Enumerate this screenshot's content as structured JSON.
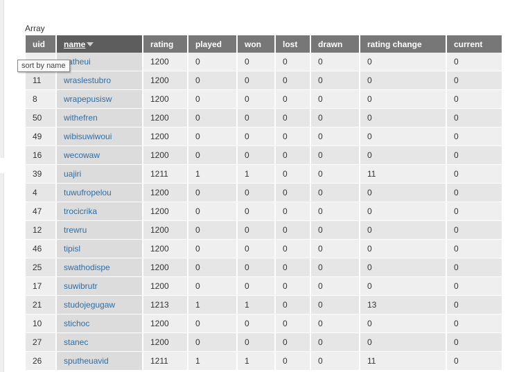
{
  "caption": "Array",
  "tooltip": "sort by name",
  "columns": [
    "uid",
    "name",
    "rating",
    "played",
    "won",
    "lost",
    "drawn",
    "rating change",
    "current"
  ],
  "sort": {
    "column": "name",
    "direction": "descending"
  },
  "rows": [
    [
      "",
      "satheui",
      "1200",
      "0",
      "0",
      "0",
      "0",
      "0",
      "0"
    ],
    [
      "11",
      "wraslestubro",
      "1200",
      "0",
      "0",
      "0",
      "0",
      "0",
      "0"
    ],
    [
      "8",
      "wrapepusisw",
      "1200",
      "0",
      "0",
      "0",
      "0",
      "0",
      "0"
    ],
    [
      "50",
      "withefren",
      "1200",
      "0",
      "0",
      "0",
      "0",
      "0",
      "0"
    ],
    [
      "49",
      "wibisuwiwoui",
      "1200",
      "0",
      "0",
      "0",
      "0",
      "0",
      "0"
    ],
    [
      "16",
      "wecowaw",
      "1200",
      "0",
      "0",
      "0",
      "0",
      "0",
      "0"
    ],
    [
      "39",
      "uajiri",
      "1211",
      "1",
      "1",
      "0",
      "0",
      "11",
      "0"
    ],
    [
      "4",
      "tuwufropelou",
      "1200",
      "0",
      "0",
      "0",
      "0",
      "0",
      "0"
    ],
    [
      "47",
      "trocicrika",
      "1200",
      "0",
      "0",
      "0",
      "0",
      "0",
      "0"
    ],
    [
      "12",
      "trewru",
      "1200",
      "0",
      "0",
      "0",
      "0",
      "0",
      "0"
    ],
    [
      "46",
      "tipisl",
      "1200",
      "0",
      "0",
      "0",
      "0",
      "0",
      "0"
    ],
    [
      "25",
      "swathodispe",
      "1200",
      "0",
      "0",
      "0",
      "0",
      "0",
      "0"
    ],
    [
      "17",
      "suwibrutr",
      "1200",
      "0",
      "0",
      "0",
      "0",
      "0",
      "0"
    ],
    [
      "21",
      "studojegugaw",
      "1213",
      "1",
      "1",
      "0",
      "0",
      "13",
      "0"
    ],
    [
      "10",
      "stichoc",
      "1200",
      "0",
      "0",
      "0",
      "0",
      "0",
      "0"
    ],
    [
      "27",
      "stanec",
      "1200",
      "0",
      "0",
      "0",
      "0",
      "0",
      "0"
    ],
    [
      "26",
      "sputheuavid",
      "1211",
      "1",
      "1",
      "0",
      "0",
      "11",
      "0"
    ]
  ]
}
